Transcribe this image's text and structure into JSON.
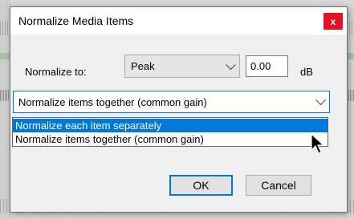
{
  "dialog": {
    "title": "Normalize Media Items",
    "close_glyph": "x"
  },
  "normalize": {
    "label": "Normalize to:",
    "selected": "Peak",
    "value": "0.00",
    "unit": "dB"
  },
  "mode_select": {
    "selected": "Normalize items together (common gain)",
    "options": [
      "Normalize each item separately",
      "Normalize items together (common gain)"
    ]
  },
  "buttons": {
    "ok": "OK",
    "cancel": "Cancel"
  },
  "colors": {
    "accent": "#0078d7",
    "close": "#e81123"
  },
  "icons": {
    "close": "close-icon",
    "dropdown": "chevron-down-icon",
    "cursor": "mouse-pointer-icon"
  }
}
